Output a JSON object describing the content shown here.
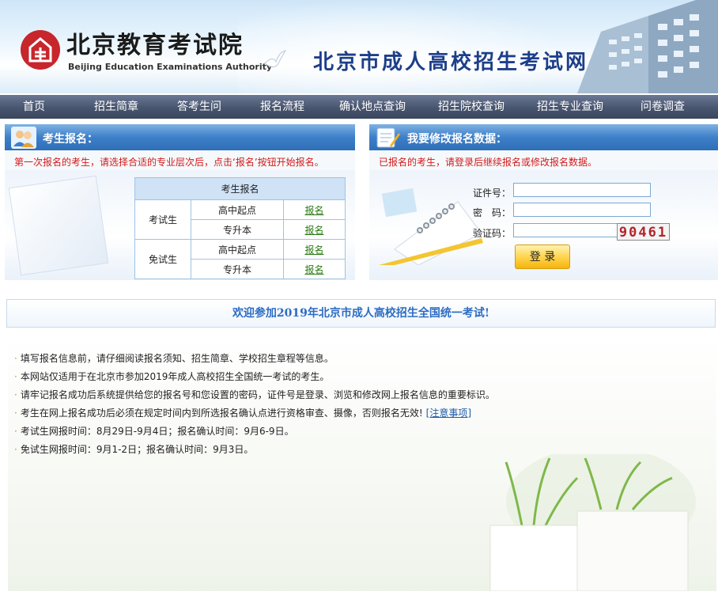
{
  "header": {
    "logo_cn": "北京教育考试院",
    "logo_en": "Beijing Education Examinations Authority",
    "site_title": "北京市成人高校招生考试网上报名"
  },
  "nav": [
    "首页",
    "招生简章",
    "答考生问",
    "报名流程",
    "确认地点查询",
    "招生院校查询",
    "招生专业查询",
    "问卷调查"
  ],
  "register_panel": {
    "title": "考生报名：",
    "note": "第一次报名的考生，请选择合适的专业层次后，点击‘报名’按钮开始报名。",
    "table_header": "考生报名",
    "groups": [
      {
        "name": "考试生",
        "rows": [
          {
            "level": "高中起点",
            "action": "报名"
          },
          {
            "level": "专升本",
            "action": "报名"
          }
        ]
      },
      {
        "name": "免试生",
        "rows": [
          {
            "level": "高中起点",
            "action": "报名"
          },
          {
            "level": "专升本",
            "action": "报名"
          }
        ]
      }
    ]
  },
  "login_panel": {
    "title": "我要修改报名数据：",
    "note": "已报名的考生，请登录后继续报名或修改报名数据。",
    "id_label": "证件号：",
    "id_value": "",
    "password_label": "密　码：",
    "password_value": "",
    "captcha_label": "验证码：",
    "captcha_value": "",
    "captcha_text": "90461",
    "login_button": "登 录"
  },
  "welcome": "欢迎参加2019年北京市成人高校招生全国统一考试!",
  "info": {
    "items": [
      "填写报名信息前，请仔细阅读报名须知、招生简章、学校招生章程等信息。",
      "本网站仅适用于在北京市参加2019年成人高校招生全国统一考试的考生。",
      "请牢记报名成功后系统提供给您的报名号和您设置的密码，证件号是登录、浏览和修改网上报名信息的重要标识。",
      "考生在网上报名成功后必须在规定时间内到所选报名确认点进行资格审查、摄像，否则报名无效!",
      "考试生网报时间：8月29日-9月4日；报名确认时间：9月6-9日。",
      "免试生网报时间：9月1-2日；报名确认时间：9月3日。"
    ],
    "notice_link": "[注意事项]"
  }
}
